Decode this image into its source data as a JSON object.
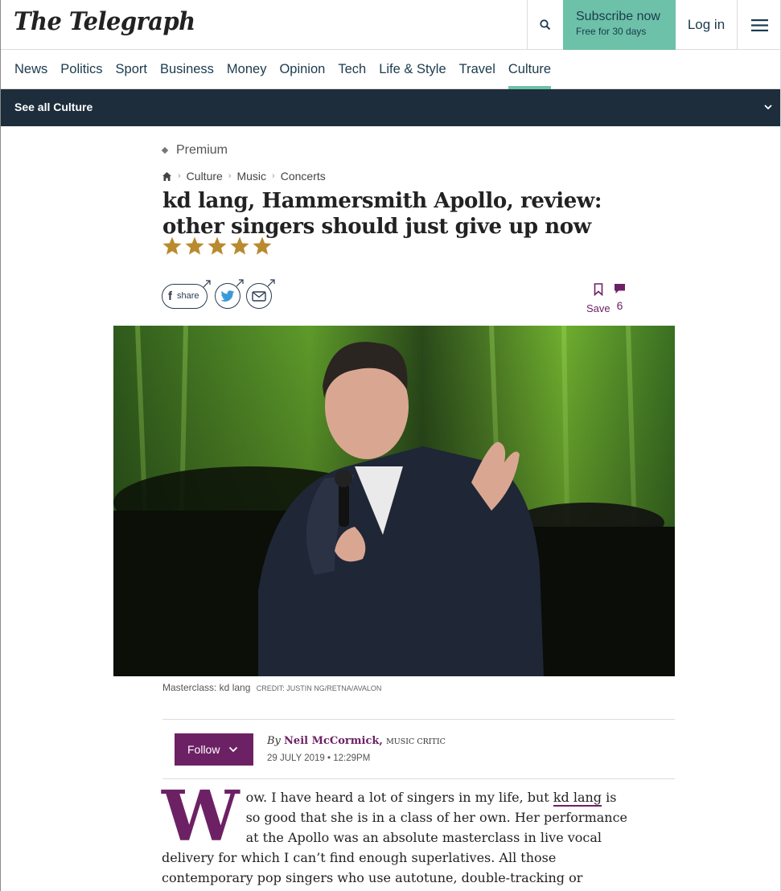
{
  "header": {
    "logo": "The Telegraph",
    "subscribe_title": "Subscribe now",
    "subscribe_sub": "Free for 30 days",
    "login": "Log in"
  },
  "nav": {
    "items": [
      "News",
      "Politics",
      "Sport",
      "Business",
      "Money",
      "Opinion",
      "Tech",
      "Life & Style",
      "Travel",
      "Culture"
    ],
    "active": "Culture"
  },
  "subnav": {
    "label": "See all Culture"
  },
  "article": {
    "premium": "Premium",
    "breadcrumbs": [
      "Culture",
      "Music",
      "Concerts"
    ],
    "headline": "kd lang, Hammersmith Apollo, review: other singers should just give up now",
    "rating": 5,
    "share_label": "share",
    "save_label": "Save",
    "comment_count": "6",
    "caption": "Masterclass: kd lang",
    "credit": "CREDIT: JUSTIN NG/RETNA/AVALON",
    "follow_label": "Follow",
    "byline_prefix": "By",
    "author": "Neil McCormick,",
    "author_role": "Music Critic",
    "date": "29 JULY 2019 • 12:29PM",
    "dropcap": "W",
    "body_part1": "ow. I have heard a lot of singers in my life, but ",
    "body_link": "kd lang",
    "body_part2": " is so good that she is in a class of her own. Her performance at the Apollo was an absolute masterclass in live vocal delivery for which I can’t find enough superlatives. All those contemporary pop singers who use autotune, double-tracking or simply mime live ought to"
  },
  "colors": {
    "accent_green": "#6cc1a8",
    "premium_purple": "#6d2165",
    "star_gold": "#b98a2e",
    "navy": "#1d2d3b"
  }
}
